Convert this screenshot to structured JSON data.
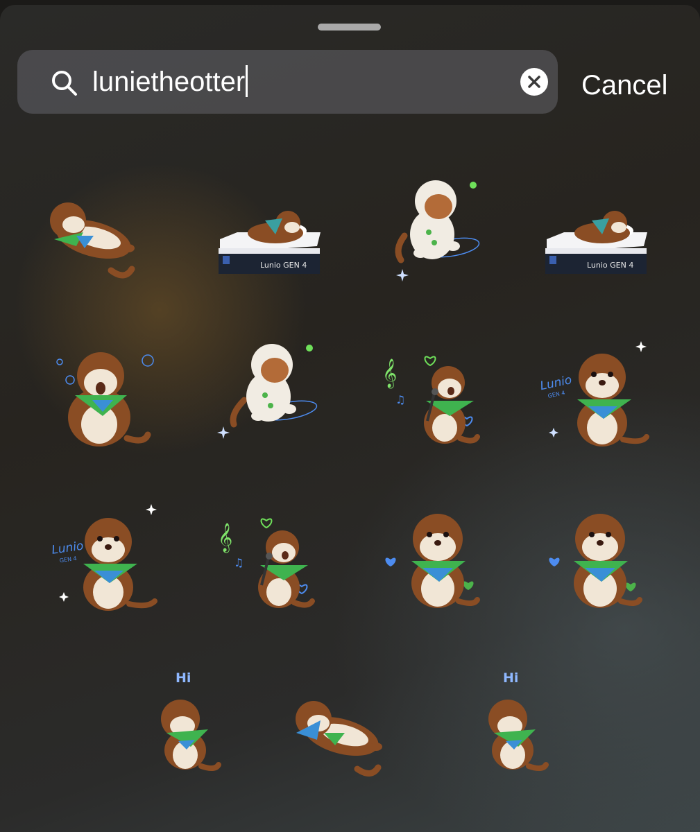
{
  "search": {
    "query": "lunietheotter",
    "cancel_label": "Cancel"
  },
  "stickers": [
    {
      "row": 1,
      "col": 1,
      "kind": "otter-lying-on-back"
    },
    {
      "row": 1,
      "col": 2,
      "kind": "otter-sleeping-on-mattress",
      "brand_text": "Lunio GEN 4"
    },
    {
      "row": 1,
      "col": 3,
      "kind": "otter-astronaut"
    },
    {
      "row": 1,
      "col": 4,
      "kind": "otter-sleeping-on-mattress",
      "brand_text": "Lunio GEN 4"
    },
    {
      "row": 2,
      "col": 1,
      "kind": "otter-yawning"
    },
    {
      "row": 2,
      "col": 2,
      "kind": "otter-astronaut"
    },
    {
      "row": 2,
      "col": 3,
      "kind": "otter-singing"
    },
    {
      "row": 2,
      "col": 4,
      "kind": "otter-thinking-lunio",
      "brand_text": "Lunio GEN 4"
    },
    {
      "row": 3,
      "col": 1,
      "kind": "otter-thinking-lunio",
      "brand_text": "Lunio GEN 4"
    },
    {
      "row": 3,
      "col": 2,
      "kind": "otter-singing"
    },
    {
      "row": 3,
      "col": 3,
      "kind": "otter-hearts"
    },
    {
      "row": 3,
      "col": 4,
      "kind": "otter-hearts"
    },
    {
      "row": 4,
      "col": 1,
      "kind": "otter-waving-hi",
      "label": "Hi"
    },
    {
      "row": 4,
      "col": 2,
      "kind": "otter-lying-on-back"
    },
    {
      "row": 4,
      "col": 3,
      "kind": "otter-waving-hi",
      "label": "Hi"
    }
  ],
  "colors": {
    "fur": "#8a4d24",
    "belly": "#f1e6d6",
    "bandana_green": "#3fb34f",
    "bandana_blue": "#3a8fd6",
    "accent_green": "#6fe05a",
    "accent_blue": "#4d8cf0"
  }
}
